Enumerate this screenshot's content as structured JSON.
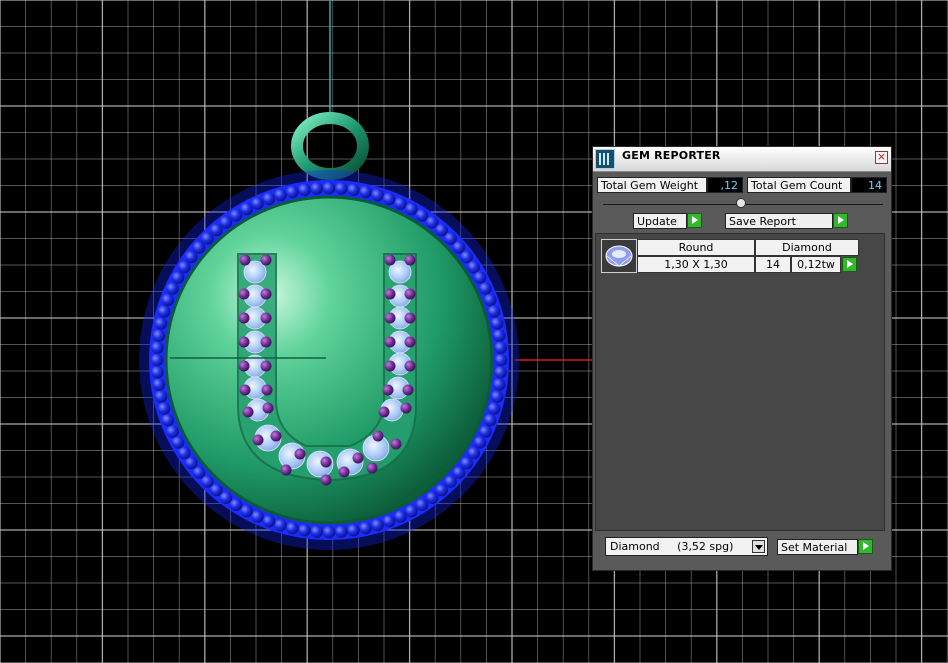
{
  "viewport": {
    "grid_color": "#bdbdbd",
    "background": "#000000",
    "pendant": {
      "letter": "U",
      "body_color": "#2fae7a",
      "bezel_color": "#1a2cff",
      "stone_color": "#b9d6ff",
      "prong_color": "#6a2a8c",
      "bail_color": "#1f9a72"
    }
  },
  "panel": {
    "title": "GEM REPORTER",
    "close_icon": "close-icon",
    "total_weight_label": "Total Gem Weight",
    "total_weight_value": ",12",
    "total_count_label": "Total Gem Count",
    "total_count_value": "14",
    "update_label": "Update",
    "save_report_label": "Save Report",
    "list": {
      "rows": [
        {
          "shape": "Round",
          "material": "Diamond",
          "size": "1,30 X 1,30",
          "count": "14",
          "weight": "0,12tw"
        }
      ]
    },
    "material_select": "Diamond     (3,52 spg)",
    "set_material_label": "Set Material"
  }
}
